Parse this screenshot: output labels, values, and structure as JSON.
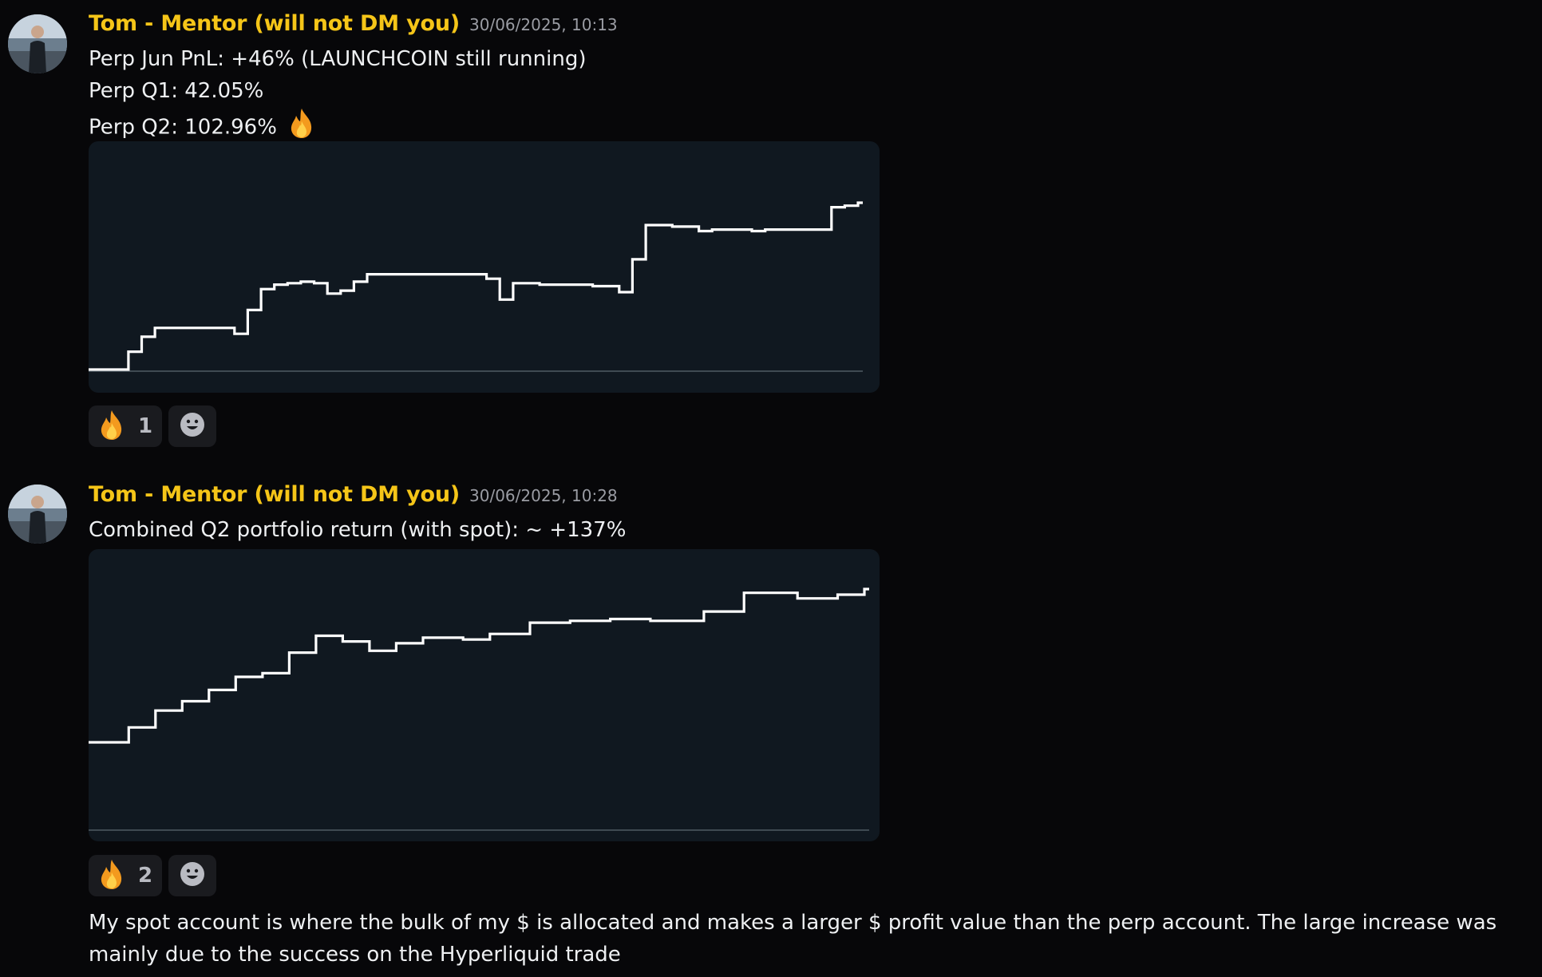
{
  "messages": [
    {
      "author": "Tom - Mentor (will not DM you)",
      "timestamp": "30/06/2025, 10:13",
      "lines": [
        "Perp Jun PnL: +46% (LAUNCHCOIN still running)",
        "Perp Q1: 42.05%",
        "Perp Q2: 102.96%"
      ],
      "line3_emoji": "fire-emoji",
      "reaction": {
        "emoji": "fire-emoji",
        "count": "1"
      },
      "add_reaction_icon": "smiley-icon"
    },
    {
      "author": "Tom - Mentor (will not DM you)",
      "timestamp": "30/06/2025, 10:28",
      "lines": [
        "Combined Q2 portfolio return (with spot): ~ +137%"
      ],
      "reaction": {
        "emoji": "fire-emoji",
        "count": "2"
      },
      "add_reaction_icon": "smiley-icon"
    }
  ],
  "followup_text": "My spot account is where the bulk of my $ is allocated and makes a larger $ profit value than the perp account. The large increase was mainly due to the success on the Hyperliquid trade",
  "colors": {
    "background": "#070709",
    "author": "#f5c518",
    "timestamp": "#9a9ca3",
    "chart_background": "#101820",
    "chart_line": "#ffffff",
    "reaction_background": "#1a1b1f"
  },
  "chart_data": [
    {
      "type": "line",
      "style": "step",
      "title": "",
      "xlabel": "",
      "ylabel": "",
      "grid": false,
      "axis_ticks": false,
      "x": [
        0,
        3,
        4,
        5,
        10,
        11,
        12,
        13,
        14,
        15,
        16,
        17,
        18,
        19,
        20,
        21,
        30,
        31,
        32,
        34,
        36,
        38,
        40,
        41,
        42,
        44,
        46,
        47,
        50,
        51,
        56,
        57,
        58
      ],
      "y": [
        0,
        12,
        22,
        28,
        28,
        24,
        40,
        54,
        57,
        58,
        59,
        58,
        51,
        53,
        59,
        64,
        61,
        47,
        58,
        57,
        57,
        56,
        52,
        74,
        97,
        96,
        93,
        94,
        93,
        94,
        109,
        110,
        112
      ]
    },
    {
      "type": "line",
      "style": "step",
      "title": "",
      "xlabel": "",
      "ylabel": "",
      "grid": false,
      "axis_ticks": false,
      "x": [
        0,
        3,
        5,
        7,
        9,
        11,
        13,
        15,
        17,
        19,
        21,
        23,
        25,
        28,
        30,
        33,
        36,
        39,
        42,
        46,
        49,
        53,
        56,
        58
      ],
      "y": [
        0,
        8,
        17,
        22,
        28,
        35,
        37,
        48,
        57,
        54,
        49,
        53,
        56,
        55,
        58,
        64,
        65,
        66,
        65,
        70,
        80,
        77,
        79,
        82
      ]
    }
  ]
}
